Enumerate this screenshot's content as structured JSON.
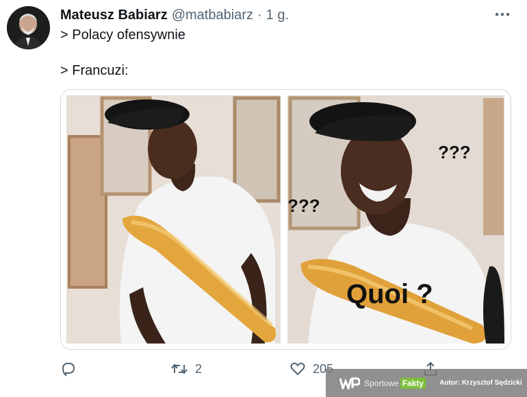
{
  "tweet": {
    "author_name": "Mateusz Babiarz",
    "handle": "@matbabiarz",
    "separator": "·",
    "time": "1 g.",
    "lines": [
      "> Polacy ofensywnie",
      "> Francuzi:"
    ]
  },
  "media": {
    "captions": {
      "question_marks": "???",
      "quoi": "Quoi ?"
    }
  },
  "actions": {
    "reply_count": "",
    "retweet_count": "2",
    "like_count": "205"
  },
  "watermark": {
    "brand_left": "Sportowe",
    "brand_right": "Fakty",
    "author": "Autor: Krzysztof Sędzicki"
  },
  "icons": [
    "avatar",
    "more-icon",
    "reply-icon",
    "retweet-icon",
    "like-icon",
    "share-icon",
    "wp-logo-icon"
  ],
  "colors": {
    "text": "#0f1419",
    "secondary": "#536471",
    "border": "#cfd9de",
    "wm_green": "#7bbf3a"
  }
}
